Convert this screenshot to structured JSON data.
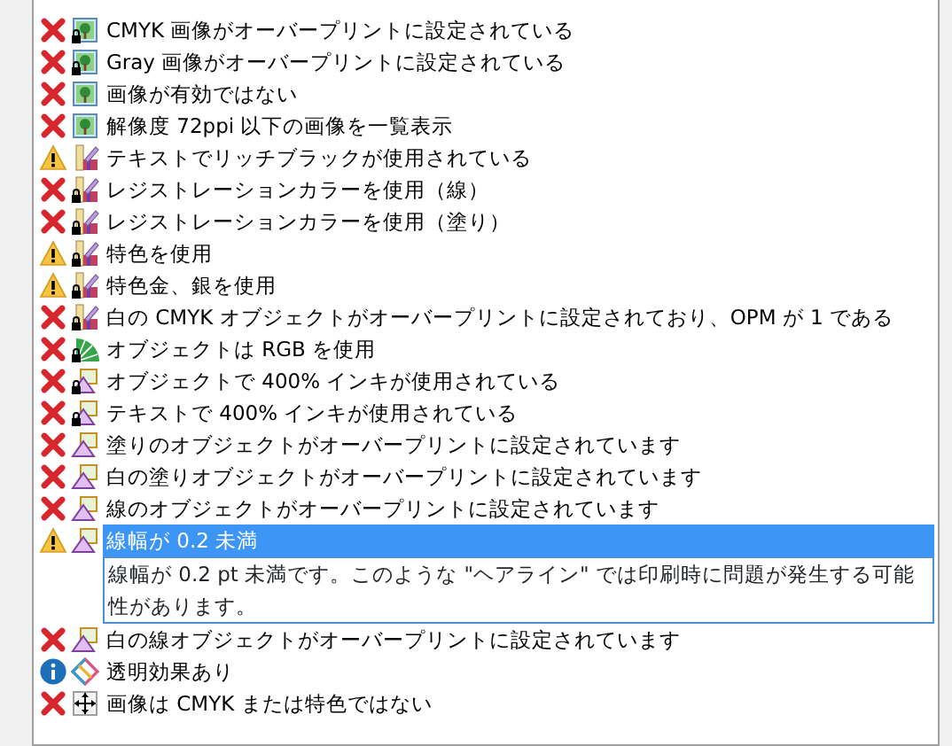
{
  "items": [
    {
      "status": {
        "kind": "error"
      },
      "object_icon": {
        "kind": "image",
        "locked": true
      },
      "label": "CMYK 画像がオーバープリントに設定されている",
      "selected": false
    },
    {
      "status": {
        "kind": "error"
      },
      "object_icon": {
        "kind": "image",
        "locked": true
      },
      "label": "Gray 画像がオーバープリントに設定されている",
      "selected": false
    },
    {
      "status": {
        "kind": "error"
      },
      "object_icon": {
        "kind": "image",
        "locked": false
      },
      "label": "画像が有効ではない",
      "selected": false
    },
    {
      "status": {
        "kind": "error"
      },
      "object_icon": {
        "kind": "image",
        "locked": false
      },
      "label": "解像度 72ppi 以下の画像を一覧表示",
      "selected": false
    },
    {
      "status": {
        "kind": "warning"
      },
      "object_icon": {
        "kind": "swatch",
        "locked": false
      },
      "label": "テキストでリッチブラックが使用されている",
      "selected": false
    },
    {
      "status": {
        "kind": "error"
      },
      "object_icon": {
        "kind": "swatch",
        "locked": true
      },
      "label": "レジストレーションカラーを使用（線）",
      "selected": false
    },
    {
      "status": {
        "kind": "error"
      },
      "object_icon": {
        "kind": "swatch",
        "locked": true
      },
      "label": "レジストレーションカラーを使用（塗り）",
      "selected": false
    },
    {
      "status": {
        "kind": "warning"
      },
      "object_icon": {
        "kind": "swatch",
        "locked": true
      },
      "label": "特色を使用",
      "selected": false
    },
    {
      "status": {
        "kind": "warning"
      },
      "object_icon": {
        "kind": "swatch",
        "locked": true
      },
      "label": "特色金、銀を使用",
      "selected": false
    },
    {
      "status": {
        "kind": "error"
      },
      "object_icon": {
        "kind": "swatch",
        "locked": true
      },
      "label": "白の CMYK オブジェクトがオーバープリントに設定されており、OPM が 1 である",
      "selected": false
    },
    {
      "status": {
        "kind": "error"
      },
      "object_icon": {
        "kind": "rgb",
        "locked": true
      },
      "label": "オブジェクトは RGB を使用",
      "selected": false
    },
    {
      "status": {
        "kind": "error"
      },
      "object_icon": {
        "kind": "shape",
        "locked": true
      },
      "label": "オブジェクトで 400% インキが使用されている",
      "selected": false
    },
    {
      "status": {
        "kind": "error"
      },
      "object_icon": {
        "kind": "shape",
        "locked": true
      },
      "label": "テキストで 400% インキが使用されている",
      "selected": false
    },
    {
      "status": {
        "kind": "error"
      },
      "object_icon": {
        "kind": "shape",
        "locked": false
      },
      "label": "塗りのオブジェクトがオーバープリントに設定されています",
      "selected": false
    },
    {
      "status": {
        "kind": "error"
      },
      "object_icon": {
        "kind": "shape",
        "locked": false
      },
      "label": "白の塗りオブジェクトがオーバープリントに設定されています",
      "selected": false
    },
    {
      "status": {
        "kind": "error"
      },
      "object_icon": {
        "kind": "shape",
        "locked": false
      },
      "label": "線のオブジェクトがオーバープリントに設定されています",
      "selected": false
    },
    {
      "status": {
        "kind": "warning"
      },
      "object_icon": {
        "kind": "shape",
        "locked": false
      },
      "label": "線幅が 0.2 未満",
      "selected": true,
      "detail": "線幅が 0.2 pt 未満です。このような \"ヘアライン\" では印刷時に問題が発生する可能性があります。"
    },
    {
      "status": {
        "kind": "error"
      },
      "object_icon": {
        "kind": "shape",
        "locked": false
      },
      "label": "白の線オブジェクトがオーバープリントに設定されています",
      "selected": false
    },
    {
      "status": {
        "kind": "info"
      },
      "object_icon": {
        "kind": "transparency",
        "locked": false
      },
      "label": "透明効果あり",
      "selected": false
    },
    {
      "status": {
        "kind": "error"
      },
      "object_icon": {
        "kind": "move",
        "locked": false
      },
      "label": "画像は CMYK または特色ではない",
      "selected": false
    }
  ]
}
